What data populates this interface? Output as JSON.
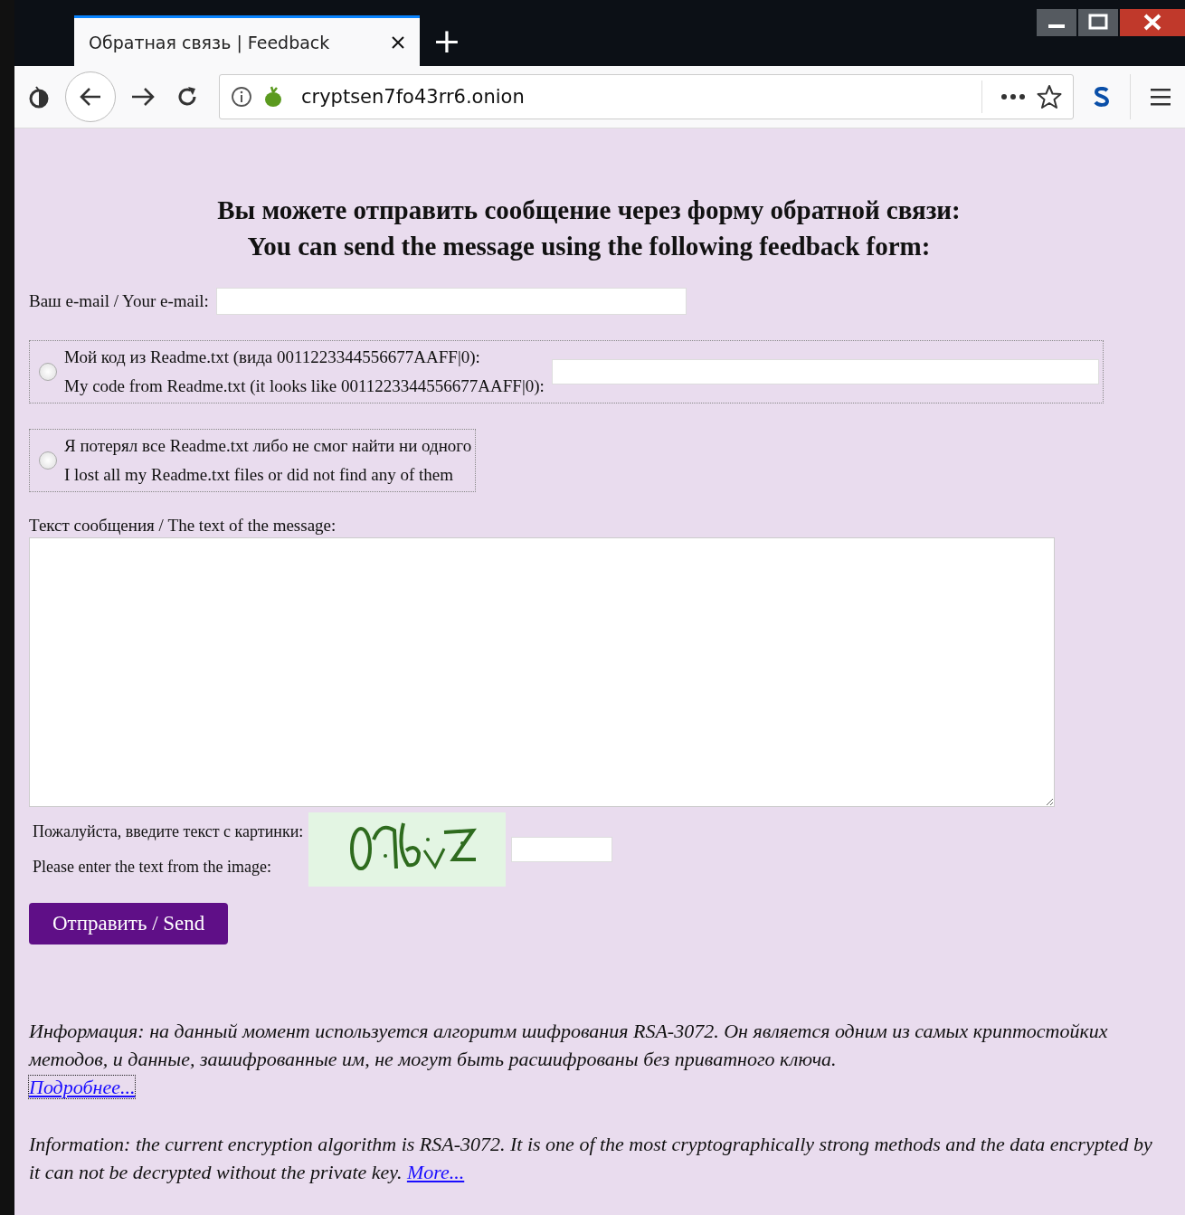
{
  "tab": {
    "title": "Обратная связь | Feedback",
    "selected": true
  },
  "new_tab": "+",
  "address_bar": {
    "url": "cryptsen7fo43rr6.onion"
  },
  "heading": [
    "Вы можете отправить сообщение через форму обратной связи:",
    "You can send the message using the following feedback form:"
  ],
  "email": {
    "label": "Ваш e-mail / Your e-mail:"
  },
  "options": [
    {
      "kind": "code",
      "selected": false,
      "lines": [
        "Мой код из Readme.txt (вида 0011223344556677AAFF|0):",
        "My code from Readme.txt (it looks like 0011223344556677AAFF|0):"
      ]
    },
    {
      "kind": "lost",
      "selected": false,
      "lines": [
        "Я потерял все Readme.txt либо не смог найти ни одного",
        "I lost all my Readme.txt files or did not find any of them"
      ]
    }
  ],
  "message": {
    "label": "Текст сообщения / The text of the message:"
  },
  "captcha": {
    "labels": [
      "Пожалуйста, введите текст с картинки:",
      "Please enter the text from the image:"
    ]
  },
  "send_button": "Отправить / Send",
  "info": [
    {
      "text": "Информация: на данный момент используется алгоритм шифрования RSA-3072. Он является одним из самых криптостойких методов, и данные, зашифрованные им, не могут быть расшифрованы без приватного ключа.",
      "link": "Подробнее...",
      "link_block": true,
      "focused": true
    },
    {
      "text": "Information: the current encryption algorithm is RSA-3072. It is one of the most cryptographically strong methods and the data encrypted by it can not be decrypted without the private key.",
      "link": "More...",
      "link_block": false,
      "focused": false
    }
  ]
}
